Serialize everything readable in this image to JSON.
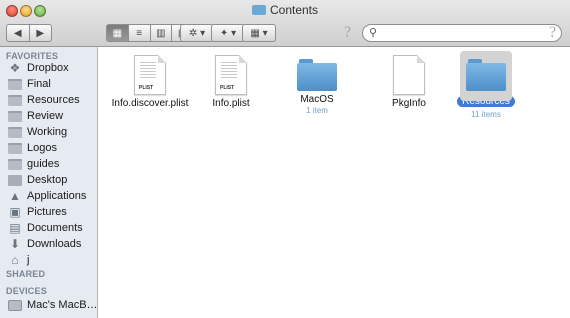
{
  "window": {
    "title": "Contents"
  },
  "toolbar": {
    "back_label": "◀",
    "forward_label": "▶",
    "view_icons": [
      "▦",
      "≡",
      "▥",
      "▤"
    ],
    "action_label": "✲ ▾",
    "dropbox_label": "✦ ▾",
    "arrange_label": "▦ ▾",
    "search_placeholder": "",
    "help_label": "?"
  },
  "sidebar": {
    "favorites_header": "FAVORITES",
    "favorites": [
      {
        "label": "Dropbox",
        "icon": "dropbox-icon"
      },
      {
        "label": "Final",
        "icon": "folder-icon"
      },
      {
        "label": "Resources",
        "icon": "folder-icon"
      },
      {
        "label": "Review",
        "icon": "folder-icon"
      },
      {
        "label": "Working",
        "icon": "folder-icon"
      },
      {
        "label": "Logos",
        "icon": "folder-icon"
      },
      {
        "label": "guides",
        "icon": "folder-icon"
      },
      {
        "label": "Desktop",
        "icon": "desktop-icon"
      },
      {
        "label": "Applications",
        "icon": "applications-icon"
      },
      {
        "label": "Pictures",
        "icon": "pictures-icon"
      },
      {
        "label": "Documents",
        "icon": "documents-icon"
      },
      {
        "label": "Downloads",
        "icon": "downloads-icon"
      },
      {
        "label": "j",
        "icon": "home-icon"
      }
    ],
    "shared_header": "SHARED",
    "devices_header": "DEVICES",
    "devices": [
      {
        "label": "Mac's MacB…",
        "icon": "laptop-icon"
      }
    ]
  },
  "files": [
    {
      "name": "Info.discover.plist",
      "kind": "plist",
      "tag": "PLIST",
      "sub": ""
    },
    {
      "name": "Info.plist",
      "kind": "plist",
      "tag": "PLIST",
      "sub": ""
    },
    {
      "name": "MacOS",
      "kind": "folder",
      "sub": "1 item"
    },
    {
      "name": "PkgInfo",
      "kind": "doc",
      "sub": ""
    },
    {
      "name": "Resources",
      "kind": "folder",
      "sub": "11 items",
      "selected": true
    }
  ],
  "colors": {
    "selection": "#3d7bd6",
    "folder": "#6aa8d8",
    "sidebar_bg": "#e6ebf1"
  }
}
